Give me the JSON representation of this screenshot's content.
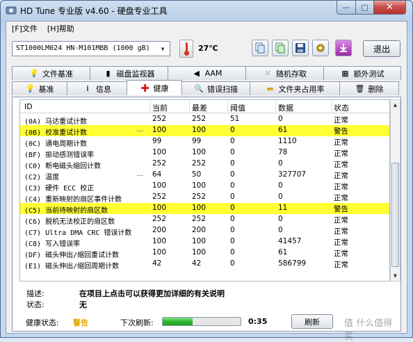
{
  "window": {
    "title": "HD Tune 专业版 v4.60 - 硬盘专业工具",
    "min_glyph": "—",
    "max_glyph": "□",
    "close_glyph": "✕"
  },
  "menu": {
    "file": "[F]文件",
    "help": "[H]帮助"
  },
  "toolbar": {
    "drive": "ST1000LM024 HN-M101MBB (1000 gB)",
    "temperature": "27℃",
    "exit_label": "退出",
    "icons": [
      "copy-icon",
      "copy-screen-icon",
      "save-icon",
      "settings-icon",
      "download-icon"
    ]
  },
  "tabs_top": [
    {
      "label": "文件基准",
      "icon": "info-bulb-icon"
    },
    {
      "label": "磁盘监视器",
      "icon": "bar-chart-icon"
    },
    {
      "label": "AAM",
      "icon": "speaker-icon"
    },
    {
      "label": "随机存取",
      "icon": "dots-icon"
    },
    {
      "label": "额外测试",
      "icon": "grid-icon"
    }
  ],
  "tabs_bottom": [
    {
      "label": "基准",
      "icon": "bulb-icon"
    },
    {
      "label": "信息",
      "icon": "info-icon"
    },
    {
      "label": "健康",
      "icon": "health-cross-icon",
      "active": true
    },
    {
      "label": "错误扫描",
      "icon": "magnifier-icon"
    },
    {
      "label": "文件夹占用率",
      "icon": "folder-icon"
    },
    {
      "label": "删除",
      "icon": "trash-icon"
    }
  ],
  "table": {
    "headers": [
      "ID",
      "当前",
      "最差",
      "阈值",
      "数据",
      "状态"
    ],
    "rows": [
      {
        "id": "(0A) 马达重试计数",
        "current": "252",
        "worst": "252",
        "threshold": "51",
        "data": "0",
        "status": "正常",
        "warn": false,
        "dots": false
      },
      {
        "id": "(0B) 校准重试计数",
        "current": "100",
        "worst": "100",
        "threshold": "0",
        "data": "61",
        "status": "警告",
        "warn": true,
        "dots": true
      },
      {
        "id": "(0C) 通电周期计数",
        "current": "99",
        "worst": "99",
        "threshold": "0",
        "data": "1110",
        "status": "正常",
        "warn": false,
        "dots": false
      },
      {
        "id": "(BF) 振动感测错误率",
        "current": "100",
        "worst": "100",
        "threshold": "0",
        "data": "78",
        "status": "正常",
        "warn": false,
        "dots": false
      },
      {
        "id": "(C0) 断电磁头缩回计数",
        "current": "252",
        "worst": "252",
        "threshold": "0",
        "data": "0",
        "status": "正常",
        "warn": false,
        "dots": false
      },
      {
        "id": "(C2) 温度",
        "current": "64",
        "worst": "50",
        "threshold": "0",
        "data": "327707",
        "status": "正常",
        "warn": false,
        "dots": true
      },
      {
        "id": "(C3) 硬件 ECC 校正",
        "current": "100",
        "worst": "100",
        "threshold": "0",
        "data": "0",
        "status": "正常",
        "warn": false,
        "dots": false
      },
      {
        "id": "(C4) 重新映射的扇区事件计数",
        "current": "252",
        "worst": "252",
        "threshold": "0",
        "data": "0",
        "status": "正常",
        "warn": false,
        "dots": false
      },
      {
        "id": "(C5) 当前待映射的扇区数",
        "current": "100",
        "worst": "100",
        "threshold": "0",
        "data": "11",
        "status": "警告",
        "warn": true,
        "dots": false
      },
      {
        "id": "(C6) 脱机无法校正的扇区数",
        "current": "252",
        "worst": "252",
        "threshold": "0",
        "data": "0",
        "status": "正常",
        "warn": false,
        "dots": false
      },
      {
        "id": "(C7) Ultra DMA CRC 错误计数",
        "current": "200",
        "worst": "200",
        "threshold": "0",
        "data": "0",
        "status": "正常",
        "warn": false,
        "dots": false
      },
      {
        "id": "(C8) 写入错误率",
        "current": "100",
        "worst": "100",
        "threshold": "0",
        "data": "41457",
        "status": "正常",
        "warn": false,
        "dots": false
      },
      {
        "id": "(DF) 磁头伸出/缩回重试计数",
        "current": "100",
        "worst": "100",
        "threshold": "0",
        "data": "61",
        "status": "正常",
        "warn": false,
        "dots": false
      },
      {
        "id": "(E1) 磁头伸出/缩回周期计数",
        "current": "42",
        "worst": "42",
        "threshold": "0",
        "data": "586799",
        "status": "正常",
        "warn": false,
        "dots": false
      }
    ]
  },
  "description": {
    "desc_label": "描述:",
    "desc_value": "在项目上点击可以获得更加详细的有关说明",
    "status_label": "状态:",
    "status_value": "无"
  },
  "statusbar": {
    "health_label": "健康状态:",
    "health_value": "警告",
    "refresh_label": "下次刷新:",
    "progress": 0.38,
    "time": "0:35",
    "button_label": "刷新",
    "watermark": "值 什么值得买"
  }
}
